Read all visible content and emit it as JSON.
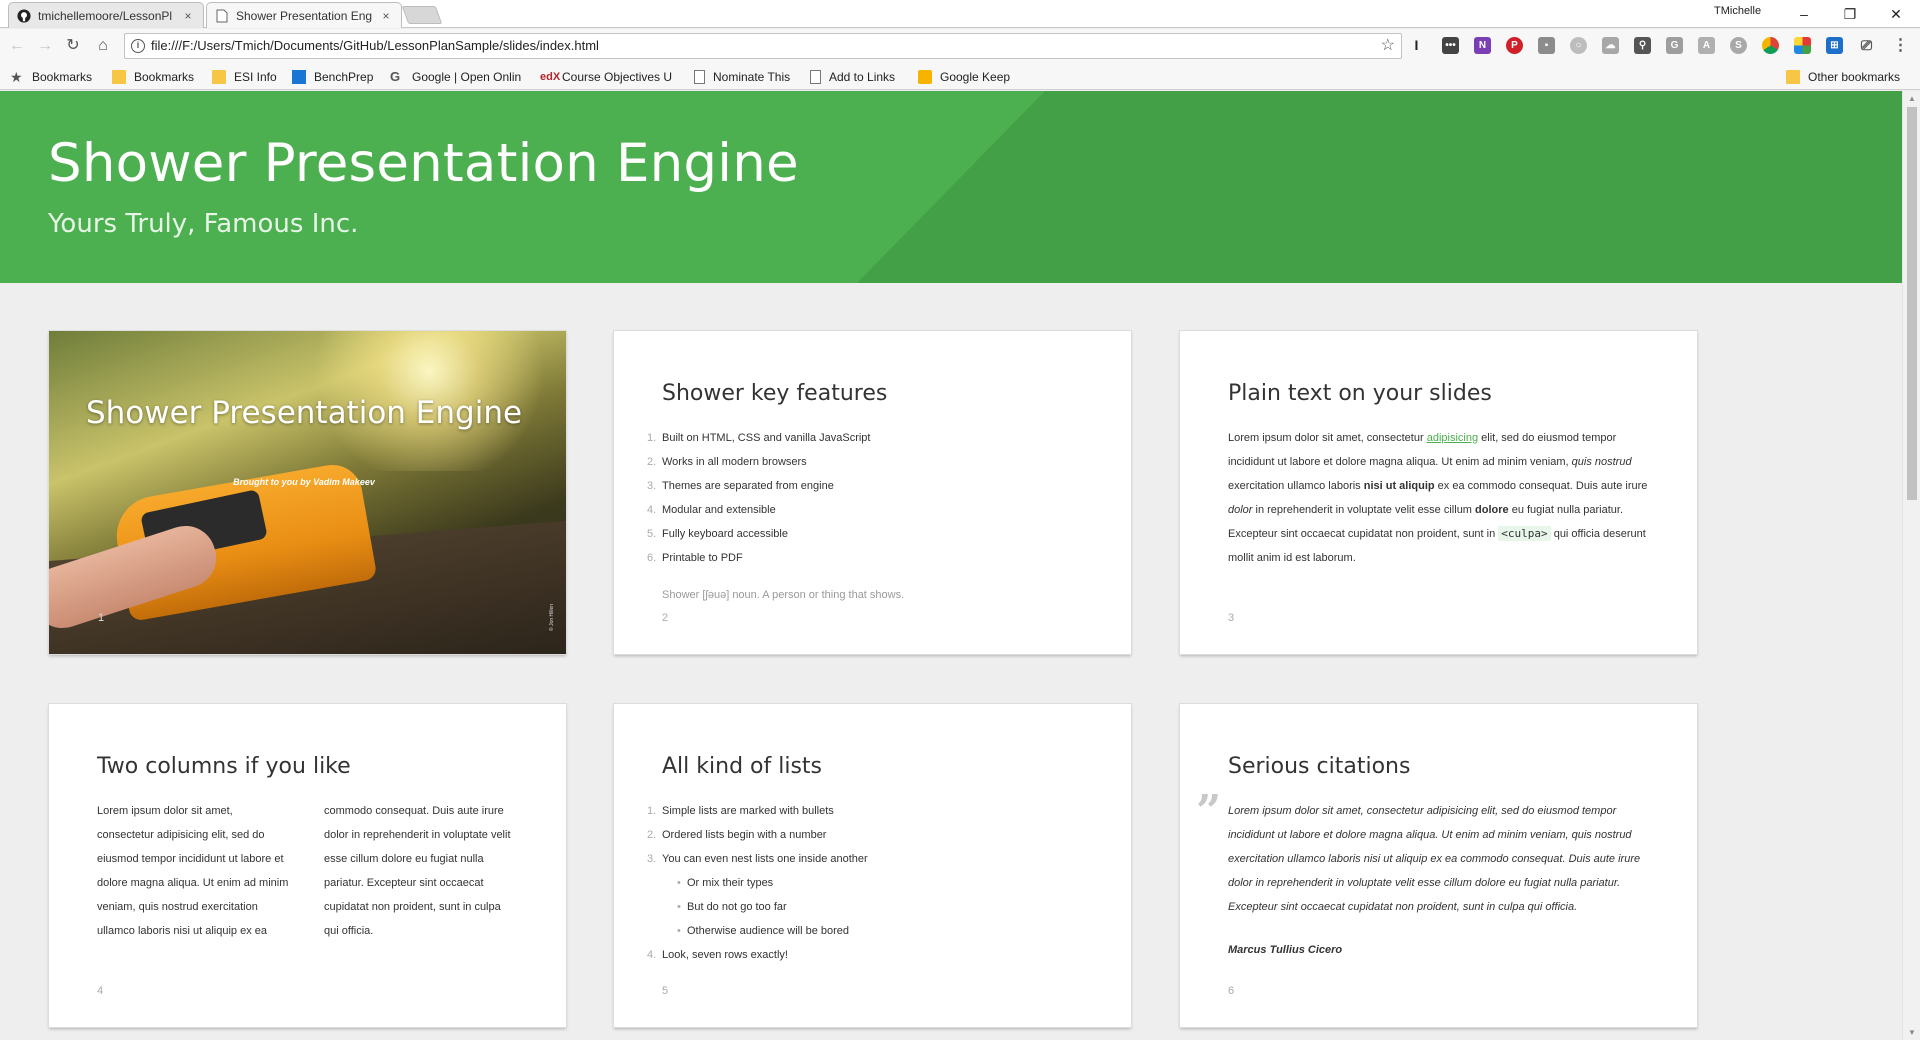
{
  "browser": {
    "tabs": [
      {
        "title": "tmichellemoore/LessonPl",
        "close": "×"
      },
      {
        "title": "Shower Presentation Eng",
        "close": "×"
      }
    ],
    "profile_name": "TMichelle",
    "window_controls": {
      "minimize": "–",
      "restore": "❐",
      "close": "✕"
    },
    "nav": {
      "back": "←",
      "forward": "→",
      "reload": "↻",
      "home": "⌂"
    },
    "address": "file:///F:/Users/Tmich/Documents/GitHub/LessonPlanSample/slides/index.html",
    "menu_glyph": "⋮",
    "extensions": [
      "cursor-icon",
      "dots-icon",
      "onenote-icon",
      "pinterest-icon",
      "clip-icon",
      "circle-icon",
      "cloud-icon",
      "pin-icon",
      "g-icon",
      "pdf-icon",
      "skype-icon",
      "chrome-icon",
      "color-icon",
      "windows-icon",
      "cast-icon"
    ],
    "bookmarks": {
      "star_label": "Bookmarks",
      "items": [
        "Bookmarks",
        "ESI Info",
        "BenchPrep",
        "Google | Open Onlin",
        "Course Objectives U",
        "Nominate This",
        "Add to Links",
        "Google Keep"
      ],
      "other": "Other bookmarks"
    }
  },
  "page": {
    "header": {
      "title": "Shower Presentation Engine",
      "subtitle": "Yours Truly, Famous Inc."
    },
    "slides": {
      "s1": {
        "title": "Shower Presentation Engine",
        "subtitle": "Brought to you by Vadim Makeev",
        "credit": "© Jon Hillen",
        "number": "1"
      },
      "s2": {
        "title": "Shower key features",
        "items": [
          "Built on HTML, CSS and vanilla JavaScript",
          "Works in all modern browsers",
          "Themes are separated from engine",
          "Modular and extensible",
          "Fully keyboard accessible",
          "Printable to PDF"
        ],
        "note": "Shower [ʃəuə] noun. A person or thing that shows.",
        "number": "2"
      },
      "s3": {
        "title": "Plain text on your slides",
        "t1": "Lorem ipsum dolor sit amet, consectetur ",
        "link": "adipisicing",
        "t2": " elit, sed do eiusmod tempor incididunt ut labore et dolore magna aliqua. Ut enim ad minim veniam, ",
        "em1": "quis nostrud",
        "t3": " exercitation ullamco laboris ",
        "strong1": "nisi ut aliquip",
        "t4": " ex ea commodo consequat. Duis aute irure ",
        "em2": "dolor",
        "t5": " in reprehenderit in voluptate velit esse cillum ",
        "strong2": "dolore",
        "t6": " eu fugiat nulla pariatur. Excepteur sint occaecat cupidatat non proident, sunt in ",
        "code": "<culpa>",
        "t7": " qui officia deserunt mollit anim id est laborum.",
        "number": "3"
      },
      "s4": {
        "title": "Two columns if you like",
        "text": "Lorem ipsum dolor sit amet, consectetur adipisicing elit, sed do eiusmod tempor incididunt ut labore et dolore magna aliqua. Ut enim ad minim veniam, quis nostrud exercitation ullamco laboris nisi ut aliquip ex ea commodo consequat. Duis aute irure dolor in reprehenderit in voluptate velit esse cillum dolore eu fugiat nulla pariatur. Excepteur sint occaecat cupidatat non proident, sunt in culpa qui officia.",
        "number": "4"
      },
      "s5": {
        "title": "All kind of lists",
        "i1": "Simple lists are marked with bullets",
        "i2": "Ordered lists begin with a number",
        "i3": "You can even nest lists one inside another",
        "n1": "Or mix their types",
        "n2": "But do not go too far",
        "n3": "Otherwise audience will be bored",
        "i4": "Look, seven rows exactly!",
        "number": "5"
      },
      "s6": {
        "title": "Serious citations",
        "quote": "Lorem ipsum dolor sit amet, consectetur adipisicing elit, sed do eiusmod tempor incididunt ut labore et dolore magna aliqua. Ut enim ad minim veniam, quis nostrud exercitation ullamco laboris nisi ut aliquip ex ea commodo consequat. Duis aute irure dolor in reprehenderit in voluptate velit esse cillum dolore eu fugiat nulla pariatur. Excepteur sint occaecat cupidatat non proident, sunt in culpa qui officia.",
        "author": "Marcus Tullius Cicero",
        "number": "6"
      }
    },
    "colors": {
      "accent": "#4caf50",
      "accent_dark": "#43a047",
      "background": "#eeeeee"
    }
  }
}
